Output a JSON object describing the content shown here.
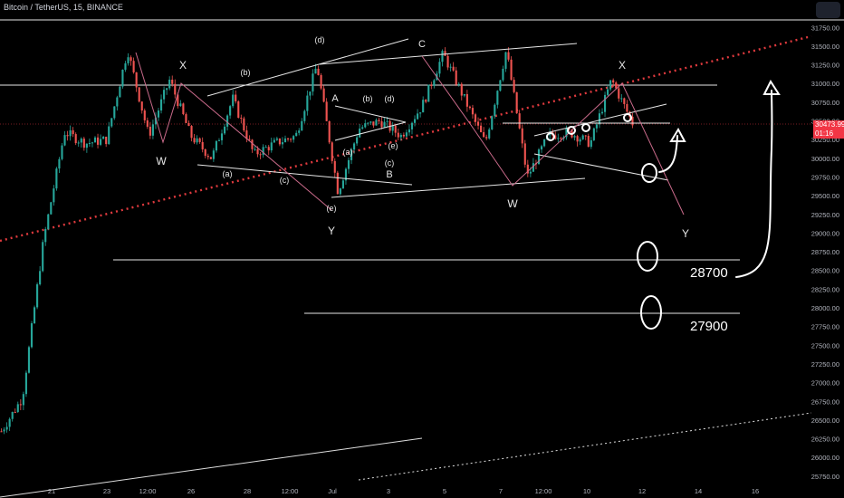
{
  "header": {
    "symbol_line": "Bitcoin / TetherUS, 15, BINANCE"
  },
  "price_axis": {
    "ticks": [
      "31750.00",
      "31500.00",
      "31250.00",
      "31000.00",
      "30750.00",
      "30500.00",
      "30250.00",
      "30000.00",
      "29750.00",
      "29500.00",
      "29250.00",
      "29000.00",
      "28750.00",
      "28500.00",
      "28250.00",
      "28000.00",
      "27750.00",
      "27500.00",
      "27250.00",
      "27000.00",
      "26750.00",
      "26500.00",
      "26250.00",
      "26000.00",
      "25750.00"
    ],
    "current_price": "30473.99",
    "countdown": "01:16"
  },
  "time_axis": {
    "ticks": [
      "21",
      "23",
      "12:00",
      "26",
      "28",
      "12:00",
      "Jul",
      "3",
      "5",
      "7",
      "12:00",
      "10",
      "12",
      "14",
      "16"
    ]
  },
  "colors": {
    "background": "#000000",
    "candle_up": "#26a69a",
    "candle_down": "#ef5350",
    "trendline_dotted": "#e03a3e",
    "drawing": "#ffffff",
    "axis_text": "#b2b5be"
  },
  "chart_data": {
    "type": "candlestick",
    "title": "Bitcoin / TetherUS, 15, BINANCE",
    "ylim": [
      25700,
      31850
    ],
    "y_scale": "linear",
    "horizontal_levels": [
      31850,
      31000,
      28700,
      27990
    ],
    "support_labels": [
      "28700",
      "27900"
    ],
    "wave_labels": [
      "X",
      "W",
      "(a)",
      "(b)",
      "(c)",
      "(d)",
      "(e)",
      "Y",
      "A",
      "(a)",
      "(b)",
      "(c)",
      "(d)",
      "(e)",
      "B",
      "C",
      "W",
      "X",
      "Y"
    ],
    "price_path": [
      {
        "t": "21",
        "price": 26350
      },
      {
        "t": "21 12:00",
        "price": 26800
      },
      {
        "t": "22",
        "price": 28900
      },
      {
        "t": "22 12:00",
        "price": 30350
      },
      {
        "t": "23",
        "price": 30200
      },
      {
        "t": "23 12:00",
        "price": 30250
      },
      {
        "t": "24",
        "price": 31450
      },
      {
        "t": "24 12:00",
        "price": 30300
      },
      {
        "t": "25",
        "price": 31050
      },
      {
        "t": "25 12:00",
        "price": 30300
      },
      {
        "t": "26",
        "price": 30000
      },
      {
        "t": "27",
        "price": 30800
      },
      {
        "t": "27 12:00",
        "price": 30050
      },
      {
        "t": "28",
        "price": 30200
      },
      {
        "t": "29",
        "price": 30300
      },
      {
        "t": "29 12:00",
        "price": 31250
      },
      {
        "t": "30",
        "price": 29550
      },
      {
        "t": "Jul 1",
        "price": 30400
      },
      {
        "t": "2",
        "price": 30500
      },
      {
        "t": "3",
        "price": 30300
      },
      {
        "t": "3 12:00",
        "price": 30700
      },
      {
        "t": "4",
        "price": 31400
      },
      {
        "t": "5",
        "price": 30800
      },
      {
        "t": "6",
        "price": 30200
      },
      {
        "t": "6 12:00",
        "price": 31450
      },
      {
        "t": "7",
        "price": 29750
      },
      {
        "t": "8",
        "price": 30300
      },
      {
        "t": "9",
        "price": 30350
      },
      {
        "t": "10",
        "price": 30200
      },
      {
        "t": "11",
        "price": 31050
      },
      {
        "t": "11 12:00",
        "price": 30470
      }
    ],
    "last_price": 30473.99,
    "grid": false,
    "legend": "none"
  }
}
